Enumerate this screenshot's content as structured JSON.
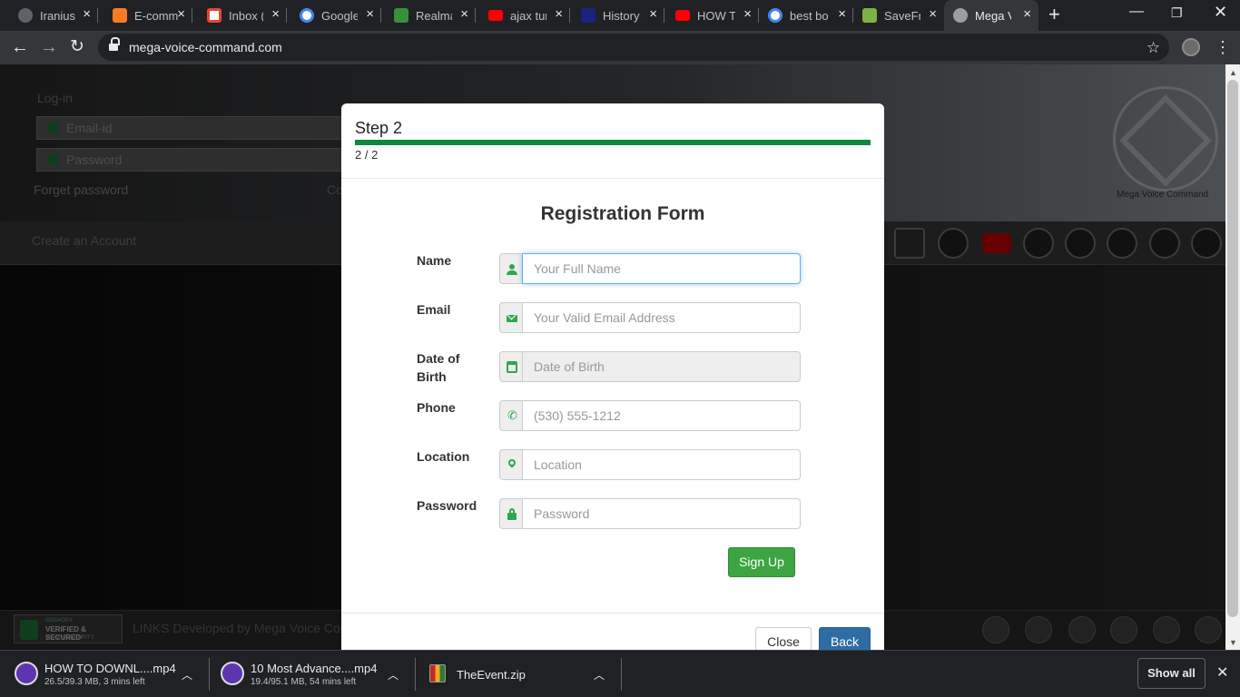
{
  "browser": {
    "tabs": [
      {
        "title": "Iranius",
        "icon": "globe-icon",
        "color": "#5f6368",
        "active": false
      },
      {
        "title": "E-comm",
        "icon": "xampp-icon",
        "color": "#fb7a24",
        "active": false
      },
      {
        "title": "Inbox (",
        "icon": "gmail-icon",
        "color": "#ea4335",
        "active": false
      },
      {
        "title": "Google",
        "icon": "google-icon",
        "color": "#4285f4",
        "active": false
      },
      {
        "title": "Realma",
        "icon": "realme-icon",
        "color": "#3a8f3a",
        "active": false
      },
      {
        "title": "ajax tur",
        "icon": "youtube-icon",
        "color": "#ff0000",
        "active": false
      },
      {
        "title": "History",
        "icon": "urics-icon",
        "color": "#1a237e",
        "active": false
      },
      {
        "title": "HOW T",
        "icon": "youtube-icon",
        "color": "#ff0000",
        "active": false
      },
      {
        "title": "best bo",
        "icon": "google-icon",
        "color": "#4285f4",
        "active": false
      },
      {
        "title": "SaveFro",
        "icon": "download-icon",
        "color": "#7cb342",
        "active": false
      },
      {
        "title": "Mega V",
        "icon": "mega-voice-icon",
        "color": "#9e9e9e",
        "active": true
      }
    ],
    "url": "mega-voice-command.com"
  },
  "background_page": {
    "login_title": "Log-in",
    "email_placeholder": "Email-id",
    "password_placeholder": "Password",
    "forget_password": "Forget password",
    "co_text": "Co",
    "logo_text": "Mega Voice Command",
    "create_account": "Create an Account",
    "footer_badge_top": "GODADDY",
    "footer_badge_mid": "VERIFIED & SECURED",
    "footer_badge_bot": "VERIFY SECURITY",
    "footer_links": "LINKS Developed by Mega Voice Command"
  },
  "modal": {
    "step_title": "Step 2",
    "progress_percent": 100,
    "step_count": "2 / 2",
    "form_title": "Registration Form",
    "fields": [
      {
        "label": "Name",
        "placeholder": "Your Full Name",
        "icon": "user-icon"
      },
      {
        "label": "Email",
        "placeholder": "Your Valid Email Address",
        "icon": "envelope-icon"
      },
      {
        "label": "Date of Birth",
        "placeholder": "Date of Birth",
        "icon": "calendar-icon"
      },
      {
        "label": "Phone",
        "placeholder": "(530) 555-1212",
        "icon": "phone-icon"
      },
      {
        "label": "Location",
        "placeholder": "Location",
        "icon": "map-pin-icon"
      },
      {
        "label": "Password",
        "placeholder": "Password",
        "icon": "lock-icon"
      }
    ],
    "signup_label": "Sign Up",
    "close_label": "Close",
    "back_label": "Back"
  },
  "downloads": [
    {
      "name": "HOW TO DOWNL....mp4",
      "status": "26.5/39.3 MB, 3 mins left",
      "icon": "mp4-icon"
    },
    {
      "name": "10 Most Advance....mp4",
      "status": "19.4/95.1 MB, 54 mins left",
      "icon": "mp4-icon"
    },
    {
      "name": "TheEvent.zip",
      "status": "",
      "icon": "zip-icon"
    }
  ],
  "show_all_label": "Show all"
}
